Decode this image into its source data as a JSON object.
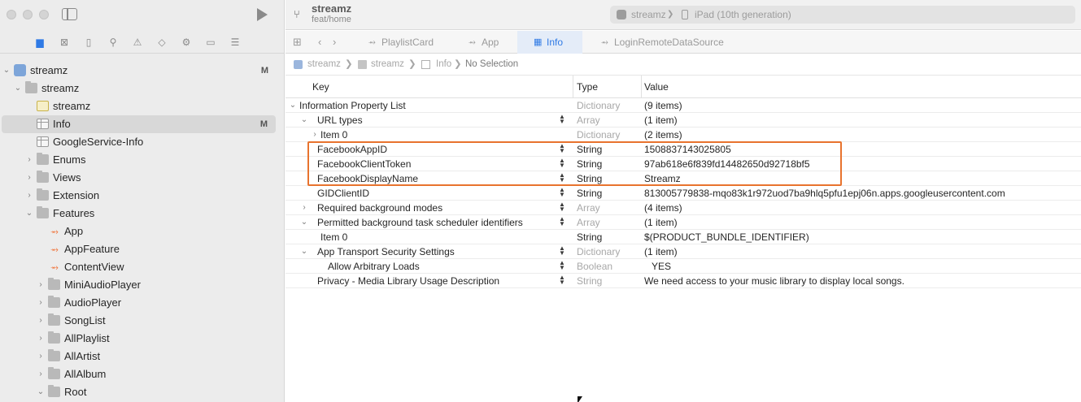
{
  "window": {
    "project": "streamz",
    "branch": "feat/home"
  },
  "scheme": {
    "target": "streamz",
    "device": "iPad (10th generation)"
  },
  "icons": {
    "navigator": [
      "folder-icon",
      "source-control-icon",
      "bookmark-icon",
      "find-icon",
      "issues-icon",
      "tests-icon",
      "debug-icon",
      "breakpoints-icon",
      "reports-icon"
    ],
    "accent": "#2f7ae5",
    "highlight": "#e8732e"
  },
  "navigator": {
    "root": {
      "label": "streamz",
      "badge": "M"
    },
    "group": {
      "label": "streamz"
    },
    "items": [
      {
        "label": "streamz",
        "kind": "asset"
      },
      {
        "label": "Info",
        "kind": "plist",
        "badge": "M"
      },
      {
        "label": "GoogleService-Info",
        "kind": "plist"
      },
      {
        "label": "Enums",
        "kind": "folder"
      },
      {
        "label": "Views",
        "kind": "folder"
      },
      {
        "label": "Extension",
        "kind": "folder"
      }
    ],
    "features": {
      "label": "Features",
      "files": [
        "App",
        "AppFeature",
        "ContentView"
      ],
      "folders": [
        "MiniAudioPlayer",
        "AudioPlayer",
        "SongList",
        "AllPlaylist",
        "AllArtist",
        "AllAlbum",
        "Root"
      ]
    }
  },
  "tabs": [
    {
      "label": "PlaylistCard",
      "icon": "swift-icon"
    },
    {
      "label": "App",
      "icon": "swift-icon"
    },
    {
      "label": "Info",
      "icon": "plist-icon",
      "active": true
    },
    {
      "label": "LoginRemoteDataSource",
      "icon": "swift-icon"
    }
  ],
  "jumpbar": [
    "streamz",
    "streamz",
    "Info",
    "No Selection"
  ],
  "table": {
    "headers": {
      "key": "Key",
      "type": "Type",
      "value": "Value"
    },
    "rows": [
      {
        "key": "Information Property List",
        "type": "Dictionary",
        "value": "(9 items)"
      },
      {
        "key": "URL types",
        "type": "Array",
        "value": "(1 item)"
      },
      {
        "key": "Item 0",
        "type": "Dictionary",
        "value": "(2 items)"
      },
      {
        "key": "FacebookAppID",
        "type": "String",
        "value": "1508837143025805"
      },
      {
        "key": "FacebookClientToken",
        "type": "String",
        "value": "97ab618e6f839fd14482650d92718bf5"
      },
      {
        "key": "FacebookDisplayName",
        "type": "String",
        "value": "Streamz"
      },
      {
        "key": "GIDClientID",
        "type": "String",
        "value": "813005779838-mqo83k1r972uod7ba9hlq5pfu1epj06n.apps.googleusercontent.com"
      },
      {
        "key": "Required background modes",
        "type": "Array",
        "value": "(4 items)"
      },
      {
        "key": "Permitted background task scheduler identifiers",
        "type": "Array",
        "value": "(1 item)"
      },
      {
        "key": "Item 0",
        "type": "String",
        "value": "$(PRODUCT_BUNDLE_IDENTIFIER)"
      },
      {
        "key": "App Transport Security Settings",
        "type": "Dictionary",
        "value": "(1 item)"
      },
      {
        "key": "Allow Arbitrary Loads",
        "type": "Boolean",
        "value": "YES"
      },
      {
        "key": "Privacy - Media Library Usage Description",
        "type": "String",
        "value": "We need access to your music library to display local songs."
      }
    ]
  }
}
